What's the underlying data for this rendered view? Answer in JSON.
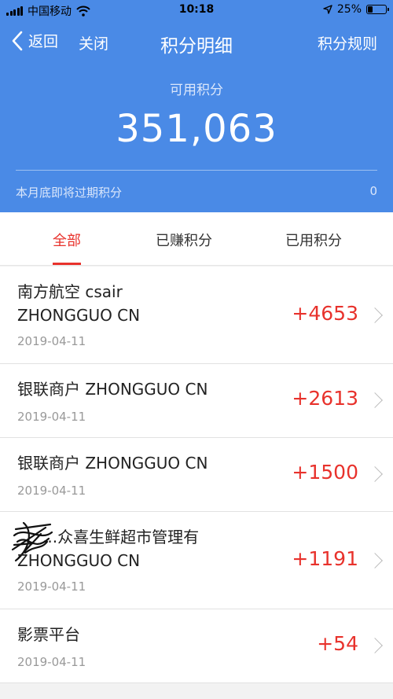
{
  "status_bar": {
    "carrier": "中国移动",
    "time": "10:18",
    "battery": "25%",
    "battery_level": 0.25
  },
  "nav": {
    "back_label": "返回",
    "close_label": "关闭",
    "title": "积分明细",
    "rules_label": "积分规则"
  },
  "summary": {
    "available_label": "可用积分",
    "available_value": "351,063",
    "expiring_label": "本月底即将过期积分",
    "expiring_value": "0"
  },
  "tabs": [
    {
      "label": "全部",
      "active": true
    },
    {
      "label": "已赚积分",
      "active": false
    },
    {
      "label": "已用积分",
      "active": false
    }
  ],
  "records": [
    {
      "line1": "南方航空 csair",
      "line2": "ZHONGGUO CN",
      "date": "2019-04-11",
      "points": "+4653"
    },
    {
      "line1": "银联商户 ZHONGGUO CN",
      "date": "2019-04-11",
      "points": "+2613"
    },
    {
      "line1": "银联商户 ZHONGGUO CN",
      "date": "2019-04-11",
      "points": "+1500"
    },
    {
      "line1": "...众喜生鲜超市管理有",
      "line2": "ZHONGGUO CN",
      "date": "2019-04-11",
      "points": "+1191"
    },
    {
      "line1": "影票平台",
      "date": "2019-04-11",
      "points": "+54"
    }
  ],
  "colors": {
    "header_blue": "#4a8ae6",
    "accent_red": "#e8322c"
  },
  "icons": [
    "signal-icon",
    "wifi-icon",
    "location-arrow-icon",
    "battery-icon",
    "back-chevron-icon",
    "chevron-right-icon"
  ]
}
